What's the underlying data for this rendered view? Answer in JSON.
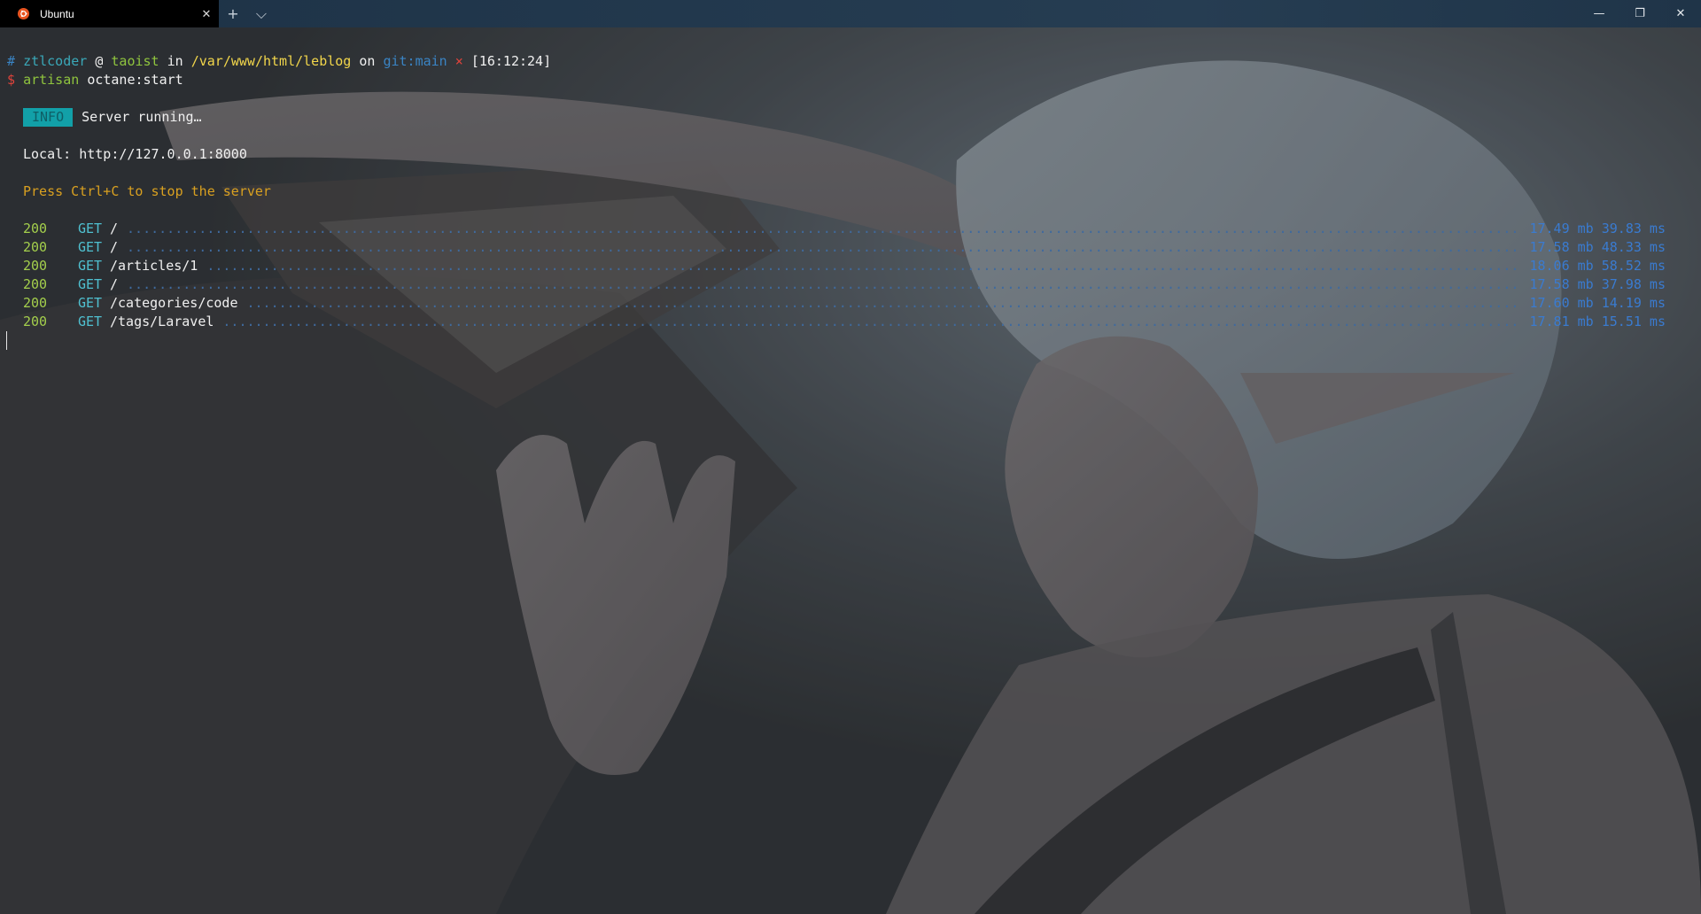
{
  "window": {
    "tab_title": "Ubuntu",
    "tab_icon": "ubuntu-logo-icon",
    "tab_close": "✕",
    "new_tab": "+",
    "dropdown": "⌵",
    "minimize": "—",
    "maximize": "❐",
    "close": "✕"
  },
  "prompt": {
    "hash": "#",
    "user": "ztlcoder",
    "at": "@",
    "host": "taoist",
    "in": "in",
    "path": "/var/www/html/leblog",
    "on": "on",
    "git_label": "git:",
    "branch": "main",
    "dirty_mark": "×",
    "time": "[16:12:24]",
    "dollar": "$",
    "command": "artisan",
    "args": "octane:start"
  },
  "output": {
    "info_badge": "INFO",
    "info_text": "Server running…",
    "local_label": "Local:",
    "local_url": "http://127.0.0.1:8000",
    "stop_hint": "Press Ctrl+C to stop the server"
  },
  "requests": [
    {
      "status": "200",
      "method": "GET",
      "path": "/",
      "metrics": "17.49 mb 39.83 ms"
    },
    {
      "status": "200",
      "method": "GET",
      "path": "/",
      "metrics": "17.58 mb 48.33 ms"
    },
    {
      "status": "200",
      "method": "GET",
      "path": "/articles/1",
      "metrics": "18.06 mb 58.52 ms"
    },
    {
      "status": "200",
      "method": "GET",
      "path": "/",
      "metrics": "17.58 mb 37.98 ms"
    },
    {
      "status": "200",
      "method": "GET",
      "path": "/categories/code",
      "metrics": "17.60 mb 14.19 ms"
    },
    {
      "status": "200",
      "method": "GET",
      "path": "/tags/Laravel",
      "metrics": "17.81 mb 15.51 ms"
    }
  ],
  "colors": {
    "tab_bg": "#000000",
    "titlebar": "#1f3448",
    "terminal_bg": "#2c2f32",
    "info_badge": "#12a0a8",
    "status_green": "#a4cf4c",
    "metric_blue": "#3a7bd0"
  }
}
